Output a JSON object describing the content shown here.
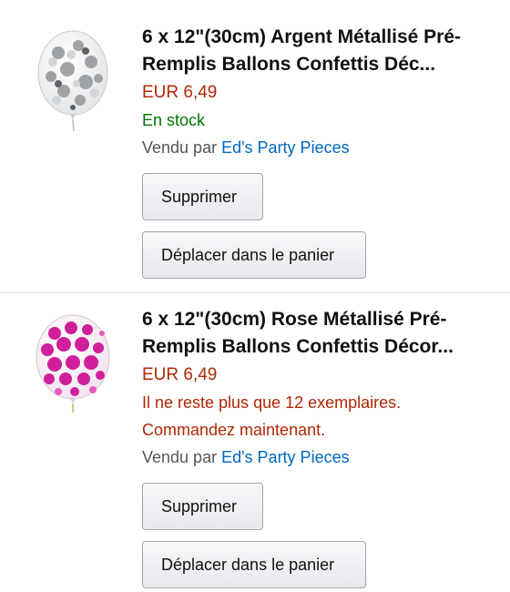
{
  "items": [
    {
      "title_line1": "6 x 12\"(30cm) Argent Métallisé Pré-",
      "title_line2": "Remplis Ballons Confettis Déc...",
      "price": "EUR 6,49",
      "stock": "En stock",
      "seller_prefix": "Vendu par",
      "seller_name": "Ed's Party Pieces",
      "delete_label": "Supprimer",
      "move_label": "Déplacer dans le panier",
      "image_icon": "silver-confetti-balloon"
    },
    {
      "title_line1": "6 x 12\"(30cm) Rose Métallisé Pré-",
      "title_line2": "Remplis Ballons Confettis Décor...",
      "price": "EUR 6,49",
      "stock_line1": "Il ne reste plus que 12 exemplaires.",
      "stock_line2": "Commandez maintenant.",
      "seller_prefix": "Vendu par",
      "seller_name": "Ed's Party Pieces",
      "delete_label": "Supprimer",
      "move_label": "Déplacer dans le panier",
      "image_icon": "pink-confetti-balloon"
    }
  ],
  "colors": {
    "price": "#b12704",
    "in_stock": "#007600",
    "seller_link": "#0066c0"
  }
}
